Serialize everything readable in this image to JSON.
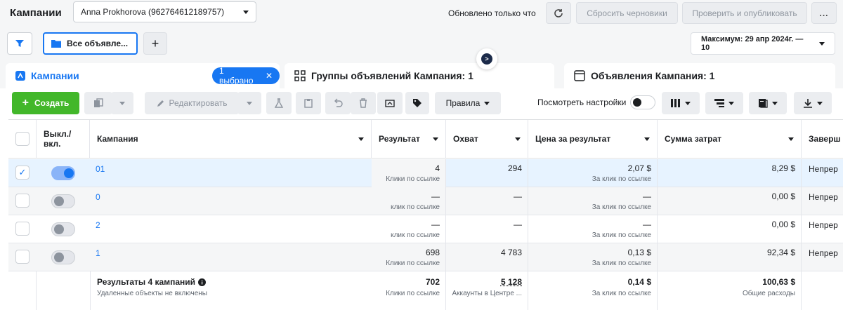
{
  "header": {
    "title": "Кампании",
    "account": "Anna Prokhorova (962764612189757)",
    "updated": "Обновлено только что",
    "discard_label": "Сбросить черновики",
    "publish_label": "Проверить и опубликовать",
    "more_label": "..."
  },
  "filters": {
    "ads_label": "Все объявле...",
    "add_label": "+",
    "date_label": "Максимум: 29 апр 2024г. — 10"
  },
  "tabs": {
    "campaigns": "Кампании",
    "selected": "1 выбрано",
    "adsets": "Группы объявлений Кампания: 1",
    "ads": "Объявления Кампания: 1"
  },
  "toolbar": {
    "create": "Создать",
    "edit": "Редактировать",
    "rules": "Правила",
    "view_settings": "Посмотреть настройки"
  },
  "table": {
    "columns": {
      "toggle": "Выкл./ вкл.",
      "campaign": "Кампания",
      "result": "Результат",
      "reach": "Охват",
      "cost": "Цена за результат",
      "spend": "Сумма затрат",
      "end": "Заверш"
    },
    "rows": [
      {
        "name": "01",
        "on": true,
        "checked": true,
        "result": "4",
        "result_sub": "Клики по ссылке",
        "reach": "294",
        "cost": "2,07 $",
        "cost_sub": "За клик по ссылке",
        "spend": "8,29 $",
        "end": "Непрер"
      },
      {
        "name": "0",
        "on": false,
        "checked": false,
        "result": "—",
        "result_sub": "клик по ссылке",
        "reach": "—",
        "cost": "—",
        "cost_sub": "За клик по ссылке",
        "spend": "0,00 $",
        "end": "Непрер"
      },
      {
        "name": "2",
        "on": false,
        "checked": false,
        "result": "—",
        "result_sub": "клик по ссылке",
        "reach": "—",
        "cost": "—",
        "cost_sub": "За клик по ссылке",
        "spend": "0,00 $",
        "end": "Непрер"
      },
      {
        "name": "1",
        "on": false,
        "checked": false,
        "result": "698",
        "result_sub": "Клики по ссылке",
        "reach": "4 783",
        "cost": "0,13 $",
        "cost_sub": "За клик по ссылке",
        "spend": "92,34 $",
        "end": "Непрер"
      }
    ],
    "totals": {
      "title": "Результаты 4 кампаний",
      "subtitle": "Удаленные объекты не включены",
      "result": "702",
      "result_sub": "Клики по ссылке",
      "reach": "5 128",
      "reach_sub": "Аккаунты в Центре ...",
      "cost": "0,14 $",
      "cost_sub": "За клик по ссылке",
      "spend": "100,63 $",
      "spend_sub": "Общие расходы"
    }
  },
  "colors": {
    "accent": "#1877f2",
    "create": "#42b72a"
  }
}
